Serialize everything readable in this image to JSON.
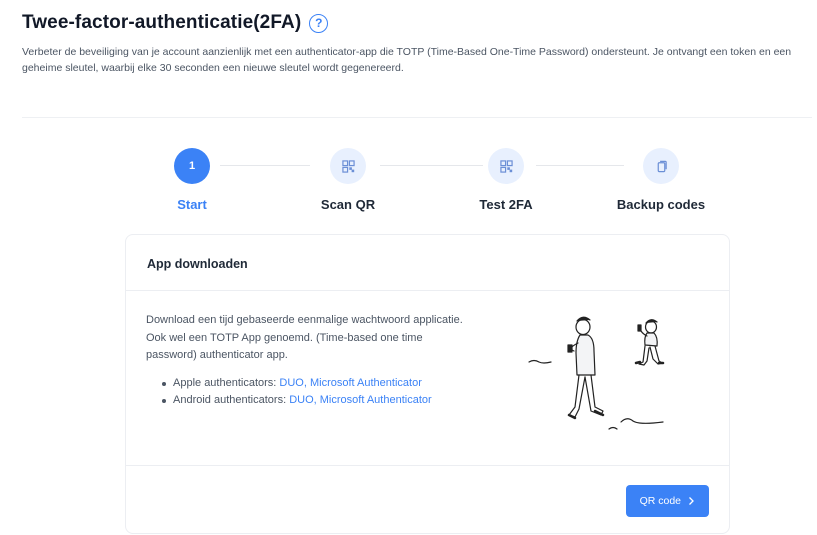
{
  "header": {
    "title": "Twee-factor-authenticatie(2FA)",
    "help_icon": "question-circle-icon",
    "description": "Verbeter de beveiliging van je account aanzienlijk met een authenticator-app die TOTP (Time-Based One-Time Password) ondersteunt. Je ontvangt een token en een geheime sleutel, waarbij elke 30 seconden een nieuwe sleutel wordt gegenereerd."
  },
  "stepper": {
    "active_color": "#3b82f6",
    "steps": [
      {
        "number": "1",
        "label": "Start",
        "icon": "number-1",
        "active": true
      },
      {
        "label": "Scan QR",
        "icon": "qr-code-icon",
        "active": false
      },
      {
        "label": "Test 2FA",
        "icon": "qr-code-icon",
        "active": false
      },
      {
        "label": "Backup codes",
        "icon": "copy-icon",
        "active": false
      }
    ]
  },
  "card": {
    "title": "App downloaden",
    "body_text": "Download een tijd gebaseerde eenmalige wachtwoord applicatie. Ook wel een TOTP App genoemd. (Time-based one time password) authenticator app.",
    "apple": {
      "prefix": "Apple authenticators: ",
      "link1": "DUO",
      "sep": ", ",
      "link2": "Microsoft Authenticator"
    },
    "android": {
      "prefix": "Android authenticators: ",
      "link1": "DUO",
      "sep": ", ",
      "link2": "Microsoft Authenticator"
    },
    "illustration": "people-using-phones-illustration",
    "button_label": "QR code",
    "button_icon": "chevron-right-icon"
  }
}
